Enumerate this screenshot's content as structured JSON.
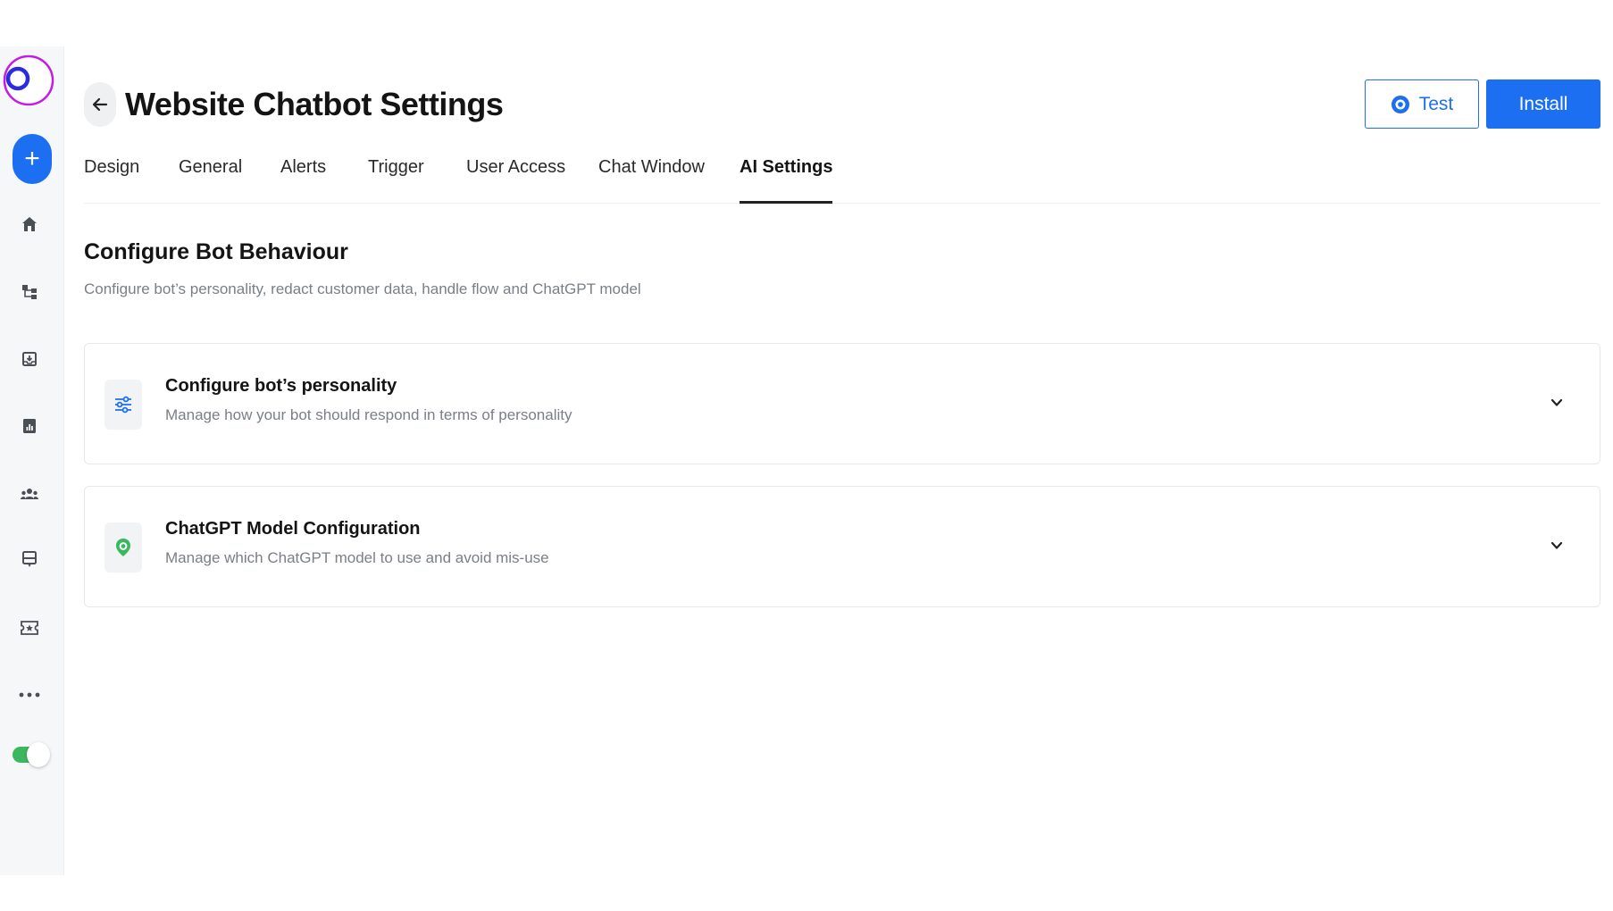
{
  "colors": {
    "accent": "#1d6ff2",
    "toggle_on": "#3bb75e",
    "logo_ring": "#c21de0",
    "logo_inner": "#2b2be0",
    "chatgpt_icon": "#3bb75e"
  },
  "sidebar": {
    "add_label": "+",
    "items": [
      {
        "icon": "home-icon"
      },
      {
        "icon": "flow-icon"
      },
      {
        "icon": "inbox-icon"
      },
      {
        "icon": "reports-icon"
      },
      {
        "icon": "contacts-icon"
      },
      {
        "icon": "chatbot-icon"
      },
      {
        "icon": "tickets-icon"
      },
      {
        "icon": "more-icon"
      }
    ],
    "toggle_on": true
  },
  "header": {
    "title": "Website Chatbot Settings",
    "test_label": "Test",
    "install_label": "Install"
  },
  "tabs": [
    {
      "label": "Design"
    },
    {
      "label": "General"
    },
    {
      "label": "Alerts"
    },
    {
      "label": "Trigger"
    },
    {
      "label": "User Access"
    },
    {
      "label": "Chat Window"
    },
    {
      "label": "AI Settings",
      "active": true
    }
  ],
  "section": {
    "title": "Configure Bot Behaviour",
    "subtitle": "Configure bot’s personality, redact customer data, handle flow and ChatGPT model"
  },
  "cards": [
    {
      "icon": "sliders-icon",
      "title": "Configure bot’s personality",
      "subtitle": "Manage how your bot should respond in terms of personality"
    },
    {
      "icon": "chatgpt-icon",
      "title": "ChatGPT Model Configuration",
      "subtitle": "Manage which ChatGPT model to use and avoid mis-use"
    }
  ]
}
